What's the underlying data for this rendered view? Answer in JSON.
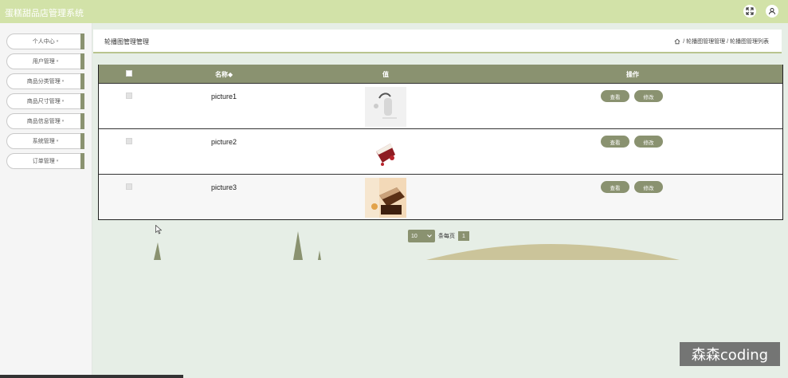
{
  "header": {
    "title": "蛋糕甜品店管理系统",
    "icons": [
      "fullscreen-icon",
      "user-icon"
    ]
  },
  "sidebar": {
    "items": [
      {
        "label": "个人中心"
      },
      {
        "label": "用户管理"
      },
      {
        "label": "商品分类管理"
      },
      {
        "label": "商品尺寸管理"
      },
      {
        "label": "商品信息管理"
      },
      {
        "label": "系统管理"
      },
      {
        "label": "订单管理"
      }
    ],
    "caret": "▾"
  },
  "page": {
    "title": "轮播图管理管理",
    "breadcrumb": {
      "home_icon": "home-icon",
      "sep": "/",
      "level1": "轮播图管理管理",
      "level2": "轮播图管理列表"
    }
  },
  "table": {
    "headers": {
      "name": "名称◆",
      "value": "值",
      "actions": "操作"
    },
    "rows": [
      {
        "name": "picture1",
        "view_label": "查看",
        "edit_label": "修改",
        "image": "cake-bottle-image"
      },
      {
        "name": "picture2",
        "view_label": "查看",
        "edit_label": "修改",
        "image": "red-velvet-cake-image"
      },
      {
        "name": "picture3",
        "view_label": "查看",
        "edit_label": "修改",
        "image": "chocolate-cake-image"
      }
    ]
  },
  "pagination": {
    "page_size": "10",
    "per_page_label": "条每页",
    "current_page": "1"
  },
  "colors": {
    "header_bg": "#d2e2a8",
    "accent": "#8a9270",
    "page_bg": "#e6eee6",
    "hill": "#cbc49a"
  },
  "watermark": "森森coding"
}
